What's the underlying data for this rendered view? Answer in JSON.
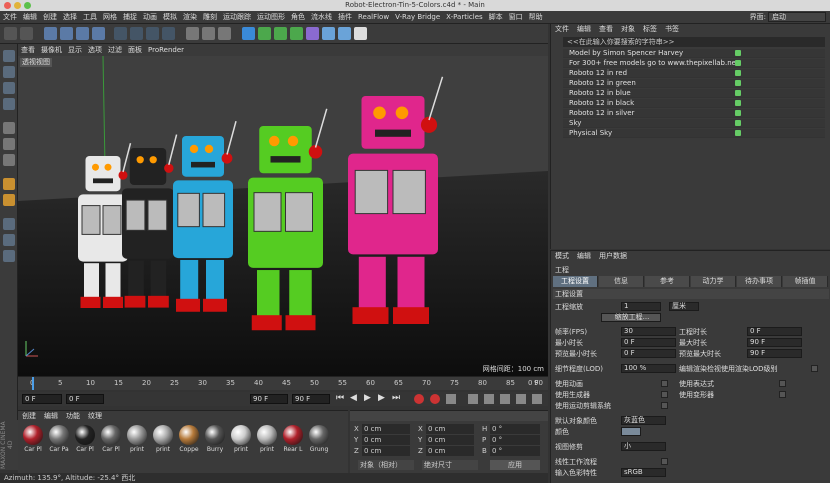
{
  "window": {
    "title": "Robot-Electron-Tin-5-Colors.c4d * - Main"
  },
  "menubar": {
    "items": [
      "文件",
      "编辑",
      "创建",
      "选择",
      "工具",
      "网格",
      "捕捉",
      "动画",
      "模拟",
      "渲染",
      "雕刻",
      "运动跟踪",
      "运动图形",
      "角色",
      "流水线",
      "插件",
      "RealFlow",
      "V-Ray Bridge",
      "X-Particles",
      "脚本",
      "窗口",
      "帮助"
    ],
    "layout_label": "界面:",
    "layout_value": "启动"
  },
  "viewport": {
    "menu": [
      "查看",
      "摄像机",
      "显示",
      "选项",
      "过滤",
      "面板",
      "ProRender"
    ],
    "label": "透视视图",
    "grid_text": "网格间距：100 cm",
    "bg_color": "#3d3d3d"
  },
  "timeline": {
    "ticks": [
      "0",
      "5",
      "10",
      "15",
      "20",
      "25",
      "30",
      "35",
      "40",
      "45",
      "50",
      "55",
      "60",
      "65",
      "70",
      "75",
      "80",
      "85",
      "90"
    ],
    "frame_right": "0 F"
  },
  "transport": {
    "start": "0 F",
    "current": "0 F",
    "end": "90 F",
    "end2": "90 F"
  },
  "materials": {
    "menu": [
      "创建",
      "编辑",
      "功能",
      "纹理"
    ],
    "items": [
      {
        "label": "Car Pl",
        "color": "#b0202a"
      },
      {
        "label": "Car Pa",
        "color": "#777"
      },
      {
        "label": "Car Pl",
        "color": "#222"
      },
      {
        "label": "Car Pl",
        "color": "#666"
      },
      {
        "label": "print",
        "color": "#999"
      },
      {
        "label": "print",
        "color": "#aaa"
      },
      {
        "label": "Coppe",
        "color": "#b67a3a"
      },
      {
        "label": "Burry",
        "color": "#555"
      },
      {
        "label": "print",
        "color": "#ccc"
      },
      {
        "label": "print",
        "color": "#bbb"
      },
      {
        "label": "Rear L",
        "color": "#b0202a"
      },
      {
        "label": "Grung",
        "color": "#666"
      }
    ]
  },
  "coords": {
    "rows": [
      {
        "a": "X",
        "av": "0 cm",
        "b": "X",
        "bv": "0 cm",
        "c": "H",
        "cv": "0 °"
      },
      {
        "a": "Y",
        "av": "0 cm",
        "b": "Y",
        "bv": "0 cm",
        "c": "P",
        "cv": "0 °"
      },
      {
        "a": "Z",
        "av": "0 cm",
        "b": "Z",
        "bv": "0 cm",
        "c": "B",
        "cv": "0 °"
      }
    ],
    "mode": "对象（相对）",
    "size_mode": "绝对尺寸",
    "apply": "应用"
  },
  "status": "Azimuth: 135.9°, Altitude: -25.4°  西北",
  "maxon": "MAXON CINEMA 4D",
  "objects": {
    "menu": [
      "文件",
      "编辑",
      "查看",
      "对象",
      "标签",
      "书签"
    ],
    "search": "<<在此输入你要搜索的字符串>>",
    "rows": [
      "Model by Simon Spencer Harvey",
      "For 300+ free models go to www.thepixellab.net",
      "Roboto 12 in red",
      "Roboto 12 in green",
      "Roboto 12 in blue",
      "Roboto 12 in black",
      "Roboto 12 in silver",
      "Sky",
      "Physical Sky"
    ]
  },
  "attributes": {
    "menu": [
      "模式",
      "编辑",
      "用户数据"
    ],
    "title": "工程",
    "tabs": [
      "工程设置",
      "信息",
      "参考",
      "动力学",
      "待办事项",
      "帧插值"
    ],
    "section": "工程设置",
    "scale_label": "工程缩放",
    "scale_value": "1",
    "scale_unit": "厘米",
    "scale_button": "缩放工程...",
    "fps_label": "帧率(FPS)",
    "fps_value": "30",
    "time_label": "工程时长",
    "time_value": "0 F",
    "min_label": "最小时长",
    "min_value": "0 F",
    "max_label": "最大时长",
    "max_value": "90 F",
    "pmin_label": "预览最小时长",
    "pmin_value": "0 F",
    "pmax_label": "预览最大时长",
    "pmax_value": "90 F",
    "lod_label": "细节程度(LOD)",
    "lod_value": "100 %",
    "lod_check": "编辑渲染检视使用渲染LOD级别",
    "c1": "使用动画",
    "c2": "使用表达式",
    "c3": "使用生成器",
    "c4": "使用变形器",
    "c5": "使用运动剪辑系统",
    "defcolor_label": "默认对象颜色",
    "defcolor_value": "灰蓝色",
    "color_label": "颜色",
    "view_label": "视图修剪",
    "view_value": "小",
    "linear_label": "线性工作流程",
    "input_label": "输入色彩特性",
    "input_value": "sRGB"
  }
}
